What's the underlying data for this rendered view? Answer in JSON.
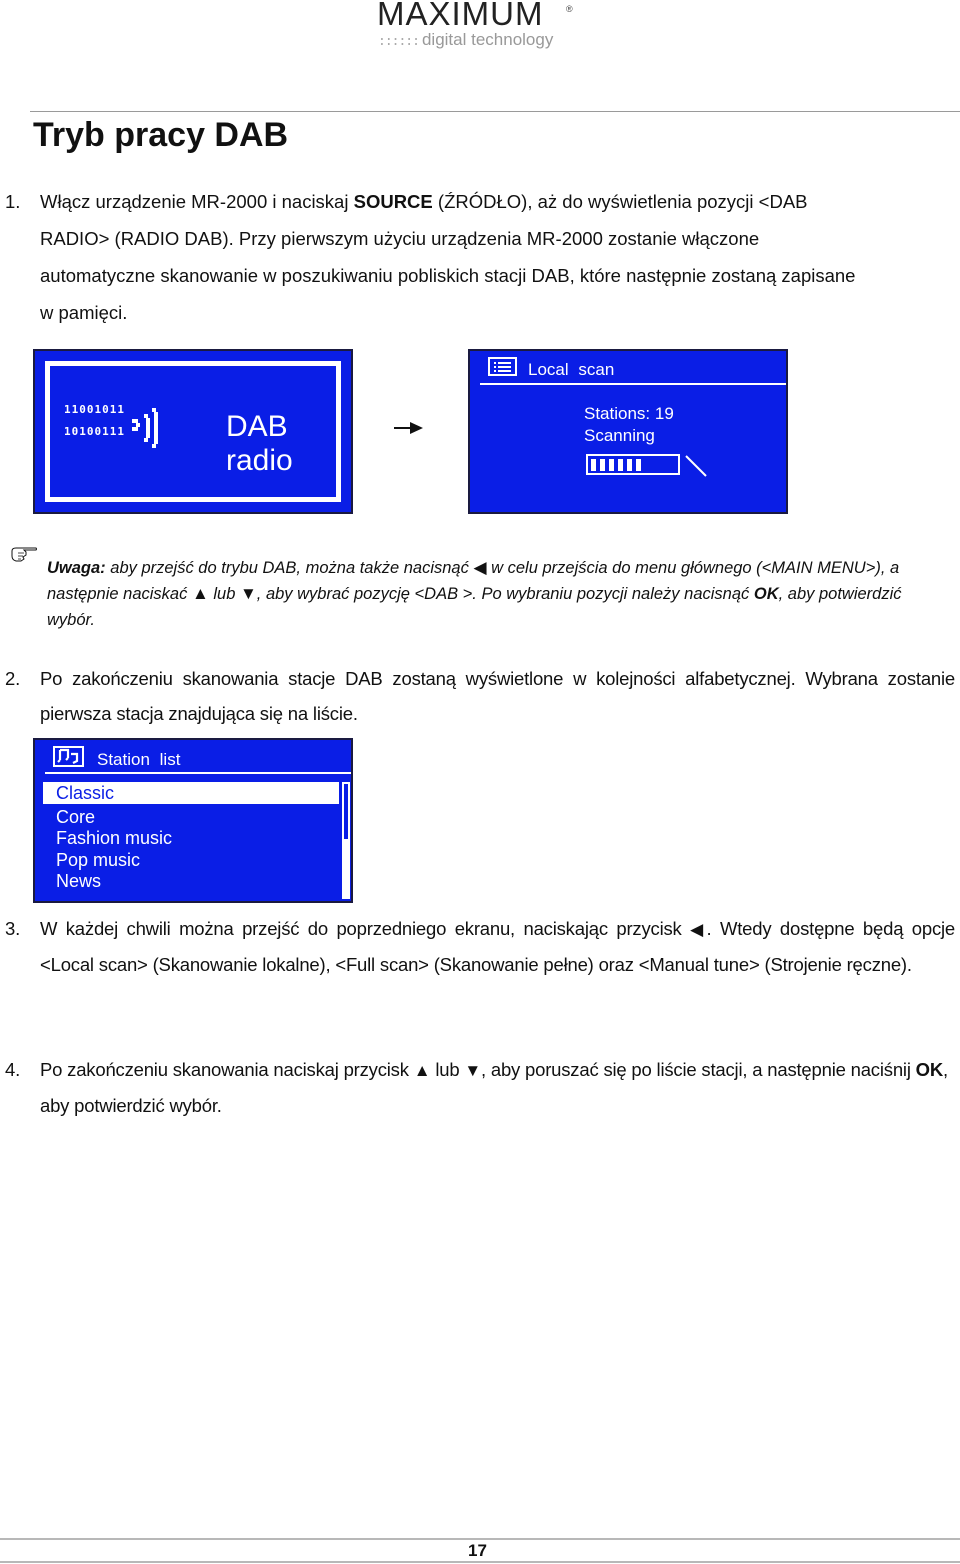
{
  "header": {
    "brand": "MAXIMUM",
    "registered": "®",
    "tagline": "digital technology",
    "tagline_dots": "::::::"
  },
  "page_title": "Tryb pracy DAB",
  "steps": [
    {
      "number": "1.",
      "text_a": "Włącz urządzenie MR-2000 i naciskaj ",
      "bold_a": "SOURCE",
      "text_b": " (ŹRÓDŁO), aż do wyświetlenia pozycji <DAB",
      "line2": "RADIO> (RADIO DAB). Przy pierwszym użyciu urządzenia MR-2000 zostanie włączone",
      "line3": "automatyczne skanowanie w poszukiwaniu pobliskich stacji DAB, które następnie zostaną zapisane",
      "line4": "w pamięci."
    },
    {
      "number": "2.",
      "text": "Po zakończeniu skanowania stacje DAB zostaną wyświetlone w kolejności alfabetycznej. Wybrana zostanie pierwsza stacja znajdująca się na liście."
    },
    {
      "number": "3.",
      "text_a": "W każdej chwili można przejść do poprzedniego ekranu, naciskając przycisk ",
      "text_b": ". Wtedy dostępne będą opcje <Local scan> (Skanowanie lokalne), <Full scan> (Skanowanie pełne) oraz <Manual tune> (Strojenie ręczne)."
    },
    {
      "number": "4.",
      "text_a": "Po zakończeniu skanowania naciskaj przycisk ",
      "text_lub": " lub ",
      "text_b": ", aby poruszać się po liście stacji, a następnie naciśnij ",
      "bold_ok": "OK",
      "text_c": ", aby potwierdzić wybór."
    }
  ],
  "screens": {
    "dab_radio": {
      "bits_row1": "11001011",
      "bits_row2": "10100111",
      "line1": "DAB",
      "line2": "radio"
    },
    "local_scan": {
      "title": "Local scan",
      "stations_label": "Stations: 19",
      "status": "Scanning",
      "progress_segments_filled": 6,
      "progress_fraction": 0.6
    },
    "station_list": {
      "title": "Station list",
      "items": [
        "Classic",
        "Core",
        "Fashion music",
        "Pop music",
        "News"
      ],
      "selected_index": 0
    },
    "lcd_color": "#0a1ee6"
  },
  "note": {
    "label": "Uwaga:",
    "text_a": "  aby przejść do trybu DAB, można także nacisnąć ",
    "text_b": " w celu przejścia do menu głównego (<MAIN MENU>), a następnie naciskać ",
    "text_lub": " lub ",
    "text_c": ", aby wybrać pozycję <DAB >. Po wybraniu pozycji należy nacisnąć ",
    "bold_ok": "OK",
    "text_d": ", aby potwierdzić wybór."
  },
  "symbols": {
    "left": "◀",
    "up": "▲",
    "down": "▼"
  },
  "footer": {
    "page_number": "17"
  }
}
